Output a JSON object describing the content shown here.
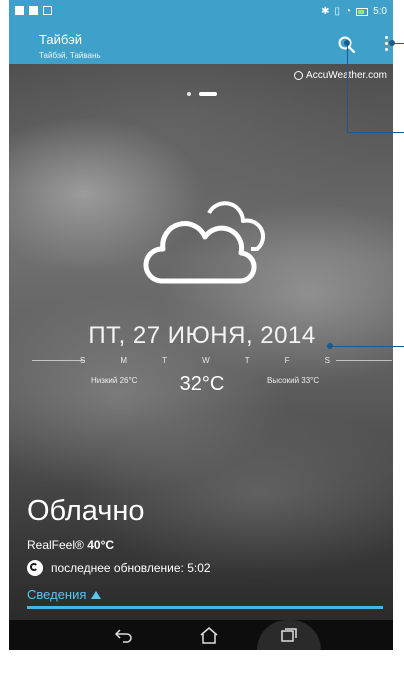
{
  "colors": {
    "accent": "#3fa1c9",
    "details_link": "#58c7f1",
    "callout": "#1a5a92"
  },
  "status_bar": {
    "time": "5:0"
  },
  "header": {
    "city": "Тайбэй",
    "region": "Тайбэй, Тайвань",
    "search_icon": "search-icon",
    "more_icon": "more-vert-icon"
  },
  "provider": {
    "label": "AccuWeather.com"
  },
  "pager": {
    "pages": 2,
    "active_index": 1
  },
  "forecast": {
    "icon": "cloudy-icon",
    "date": "ПТ, 27 ИЮНЯ, 2014",
    "days": [
      "S",
      "M",
      "T",
      "W",
      "T",
      "F",
      "S"
    ],
    "low": "Низкий 26°C",
    "temperature": "32°C",
    "high": "Высокий 33°C"
  },
  "details": {
    "condition": "Облачно",
    "realfeel_label": "RealFeel®",
    "realfeel_value": "40°C",
    "last_update": "последнее обновление: 5:02",
    "more_link": "Сведения"
  },
  "nav": {
    "back_icon": "back-icon",
    "home_icon": "home-icon",
    "recent_icon": "recent-apps-icon"
  }
}
